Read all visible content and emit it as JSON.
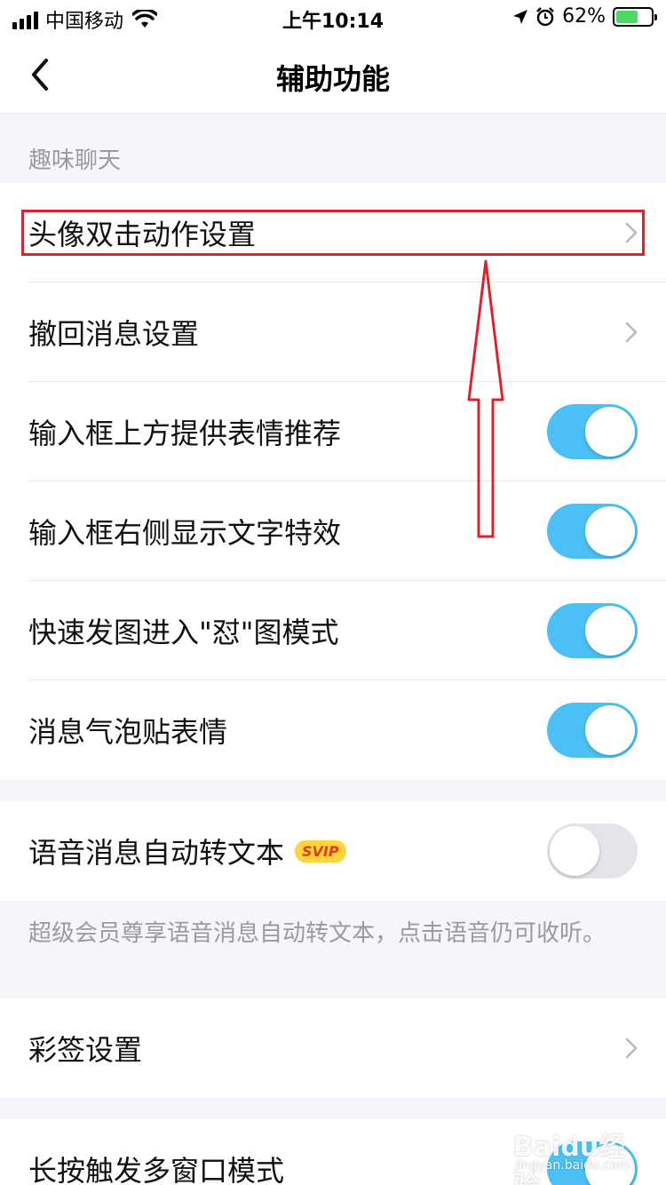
{
  "status_bar": {
    "carrier": "中国移动",
    "time": "上午10:14",
    "battery_percent": "62%",
    "battery_level": 0.62,
    "icons": [
      "signal-icon",
      "wifi-icon",
      "location-icon",
      "alarm-icon",
      "battery-charging-icon"
    ]
  },
  "nav": {
    "title": "辅助功能",
    "back_icon": "chevron-left-icon"
  },
  "section_fun_chat": {
    "header": "趣味聊天",
    "items": [
      {
        "label": "头像双击动作设置",
        "control": "chevron"
      },
      {
        "label": "撤回消息设置",
        "control": "chevron"
      },
      {
        "label": "输入框上方提供表情推荐",
        "control": "toggle",
        "on": true
      },
      {
        "label": "输入框右侧显示文字特效",
        "control": "toggle",
        "on": true
      },
      {
        "label": "快速发图进入\"怼\"图模式",
        "control": "toggle",
        "on": true
      },
      {
        "label": "消息气泡贴表情",
        "control": "toggle",
        "on": true
      }
    ]
  },
  "voice_to_text": {
    "label": "语音消息自动转文本",
    "badge": "SVIP",
    "on": false,
    "note": "超级会员尊享语音消息自动转文本，点击语音仍可收听。"
  },
  "color_tag": {
    "label": "彩签设置"
  },
  "multi_window": {
    "label": "长按触发多窗口模式",
    "on": true
  },
  "watermark": {
    "text": "Baidu经验",
    "sub": "jingyan.baidu.com"
  },
  "colors": {
    "toggle_on": "#4CC0F5",
    "toggle_off": "#E4E4EA",
    "annotation_red": "#E0202A",
    "svip_badge": "#FFD43B"
  }
}
